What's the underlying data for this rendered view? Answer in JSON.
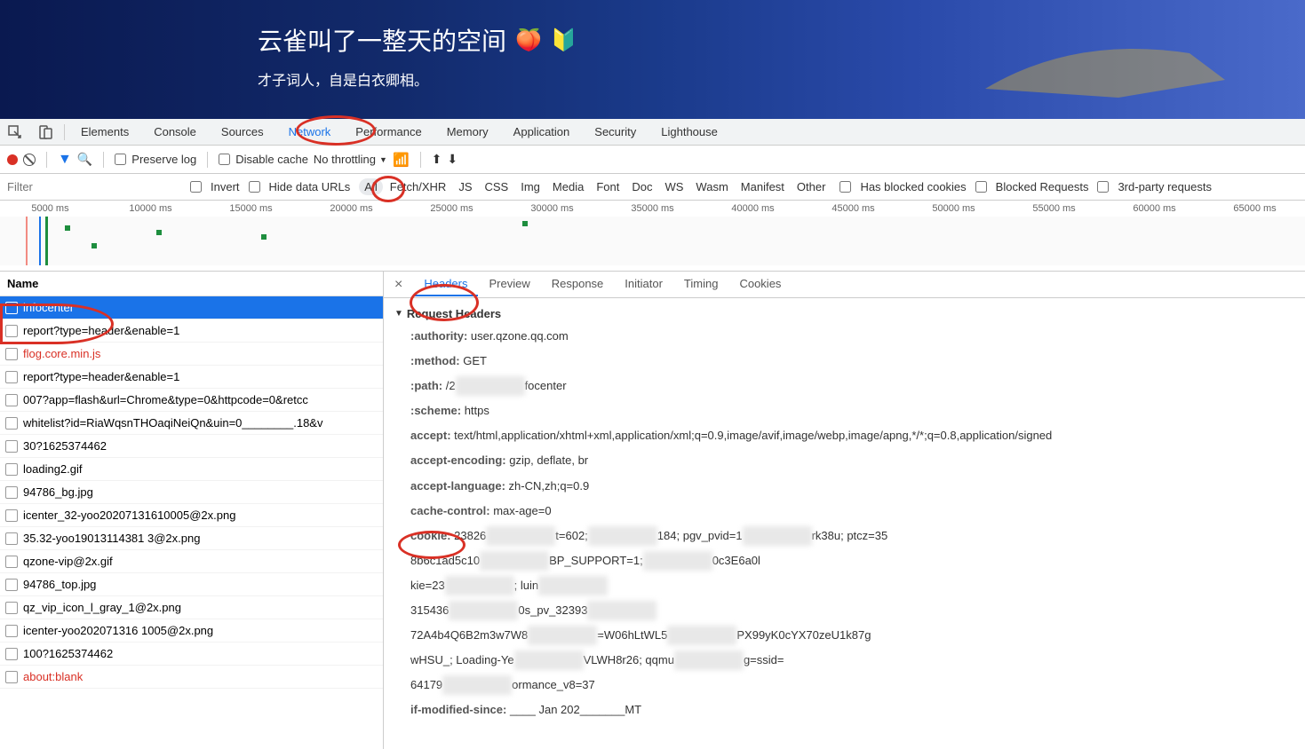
{
  "banner": {
    "title": "云雀叫了一整天的空间",
    "subtitle": "才子词人，自是白衣卿相。"
  },
  "devtools_tabs": [
    "Elements",
    "Console",
    "Sources",
    "Network",
    "Performance",
    "Memory",
    "Application",
    "Security",
    "Lighthouse"
  ],
  "devtools_active": "Network",
  "toolbar": {
    "preserve_log": "Preserve log",
    "disable_cache": "Disable cache",
    "throttling": "No throttling"
  },
  "filterbar": {
    "placeholder": "Filter",
    "invert": "Invert",
    "hide_data": "Hide data URLs",
    "types": [
      "All",
      "Fetch/XHR",
      "JS",
      "CSS",
      "Img",
      "Media",
      "Font",
      "Doc",
      "WS",
      "Wasm",
      "Manifest",
      "Other"
    ],
    "active_type": "All",
    "has_blocked": "Has blocked cookies",
    "blocked_req": "Blocked Requests",
    "third_party": "3rd-party requests"
  },
  "timeline": [
    "5000 ms",
    "10000 ms",
    "15000 ms",
    "20000 ms",
    "25000 ms",
    "30000 ms",
    "35000 ms",
    "40000 ms",
    "45000 ms",
    "50000 ms",
    "55000 ms",
    "60000 ms",
    "65000 ms"
  ],
  "list_header": "Name",
  "requests": [
    {
      "name": "infocenter",
      "selected": true
    },
    {
      "name": "report?type=header&enable=1"
    },
    {
      "name": "flog.core.min.js",
      "error": true
    },
    {
      "name": "report?type=header&enable=1"
    },
    {
      "name": "007?app=flash&url=Chrome&type=0&httpcode=0&retcc"
    },
    {
      "name": "whitelist?id=RiaWqsnTHOaqiNeiQn&uin=0________.18&v"
    },
    {
      "name": "30?1625374462"
    },
    {
      "name": "loading2.gif"
    },
    {
      "name": "94786_bg.jpg"
    },
    {
      "name": "icenter_32-yoo20207131610005@2x.png"
    },
    {
      "name": "35.32-yoo19013114381 3@2x.png"
    },
    {
      "name": "qzone-vip@2x.gif"
    },
    {
      "name": "94786_top.jpg"
    },
    {
      "name": "qz_vip_icon_l_gray_1@2x.png"
    },
    {
      "name": "icenter-yoo202071316 1005@2x.png"
    },
    {
      "name": "100?1625374462"
    },
    {
      "name": "about:blank",
      "error": true
    }
  ],
  "detail_tabs": [
    "Headers",
    "Preview",
    "Response",
    "Initiator",
    "Timing",
    "Cookies"
  ],
  "detail_active": "Headers",
  "headers_section": "Request Headers",
  "headers": [
    {
      "key": ":authority:",
      "val": "user.qzone.qq.com"
    },
    {
      "key": ":method:",
      "val": "GET",
      "blur": true
    },
    {
      "key": ":path:",
      "val": "/2________focenter",
      "partial_blur": true
    },
    {
      "key": ":scheme:",
      "val": "https"
    },
    {
      "key": "accept:",
      "val": "text/html,application/xhtml+xml,application/xml;q=0.9,image/avif,image/webp,image/apng,*/*;q=0.8,application/signed"
    },
    {
      "key": "accept-encoding:",
      "val": "gzip, deflate, br"
    },
    {
      "key": "accept-language:",
      "val": "zh-CN,zh;q=0.9"
    },
    {
      "key": "cache-control:",
      "val": "max-age=0"
    },
    {
      "key": "cookie:",
      "val": "23826________t=602;________184; pgv_pvid=1________rk38u; ptcz=35"
    },
    {
      "key": "",
      "val": "8b6c1ad5c10________BP_SUPPORT=1;________0c3E6a0l"
    },
    {
      "key": "",
      "val": "kie=23________; luin________"
    },
    {
      "key": "",
      "val": "315436________0s_pv_32393________"
    },
    {
      "key": "",
      "val": "72A4b4Q6B2m3w7W8________=W06hLtWL5________PX99yK0cYX70zeU1k87g"
    },
    {
      "key": "",
      "val": "wHSU_; Loading-Ye________VLWH8r26; qqmu________g=ssid="
    },
    {
      "key": "",
      "val": "64179________ormance_v8=37"
    },
    {
      "key": "if-modified-since:",
      "val": "____ Jan 202_______MT"
    }
  ]
}
